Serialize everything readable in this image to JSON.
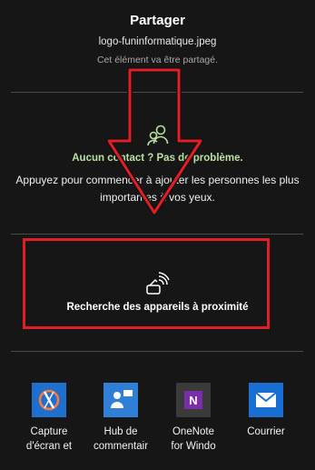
{
  "header": {
    "title": "Partager",
    "filename": "logo-funinformatique.jpeg",
    "subtitle": "Cet élément va être partagé."
  },
  "contacts": {
    "icon": "people-icon",
    "title": "Aucun contact ? Pas de problème.",
    "description": "Appuyez pour commencer à ajouter les personnes les plus importantes à vos yeux."
  },
  "nearby": {
    "icon": "nearby-share-icon",
    "label": "Recherche des appareils à proximité"
  },
  "apps": [
    {
      "icon": "snip-sketch-icon",
      "name_line1": "Capture",
      "name_line2": "d'écran et",
      "color": "#1f6fce"
    },
    {
      "icon": "feedback-hub-icon",
      "name_line1": "Hub de",
      "name_line2": "commentair",
      "color": "#2f7fd6"
    },
    {
      "icon": "onenote-icon",
      "name_line1": "OneNote",
      "name_line2": "for Windo",
      "color": "#3a3a3a"
    },
    {
      "icon": "mail-icon",
      "name_line1": "Courrier",
      "name_line2": "",
      "color": "#1a6fd4"
    }
  ],
  "colors": {
    "background": "#161616",
    "accent_green": "#b8e0a0",
    "annotation_red": "#e21d23"
  }
}
